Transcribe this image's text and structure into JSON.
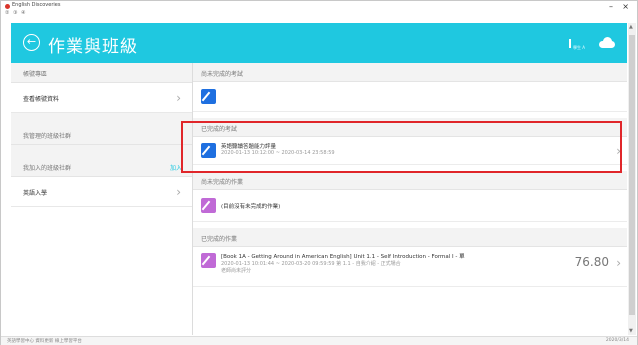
{
  "window": {
    "title": "English Discoveries",
    "menu": "② ③ ④",
    "minimize": "–",
    "close": "×"
  },
  "header": {
    "title": "作業與班級",
    "user_text": "學生 A",
    "accent": "#1fc8e0"
  },
  "sidebar": {
    "section1_title": "帳號專區",
    "item_manage": "查看帳號資料",
    "section2_title": "我管理的班級社群",
    "section3_title": "我加入的班級社群",
    "join_label": "加入",
    "item_class": "英語入學"
  },
  "main": {
    "pending_exams": "尚未完成的考試",
    "completed_exams": "已完成的考試",
    "exam_title": "英語聽讀答題能力評量",
    "exam_time": "2020-01-13 10:12:00 ~ 2020-03-14 23:58:59",
    "pending_homework": "尚未完成的作業",
    "pending_homework_empty": "(目前沒有未完成的作業)",
    "completed_homework": "已完成的作業",
    "hw_title": "[Book 1A - Getting Around in American English] Unit 1.1 - Self Introduction - Formal I - 單",
    "hw_time": "2020-01-13 10:01:44 ~ 2020-03-20 09:59:59   第 1.1 - 自我介紹 - 正式場合",
    "hw_note": "老師尚未評分",
    "hw_score": "76.80"
  },
  "status": {
    "left": "英語學習中心 資料更新 線上學習平台",
    "right": "2020/3/14"
  },
  "colors": {
    "blue_icon": "#1e6fe0",
    "purple_icon": "#c06ad6",
    "highlight": "#e0262a"
  }
}
